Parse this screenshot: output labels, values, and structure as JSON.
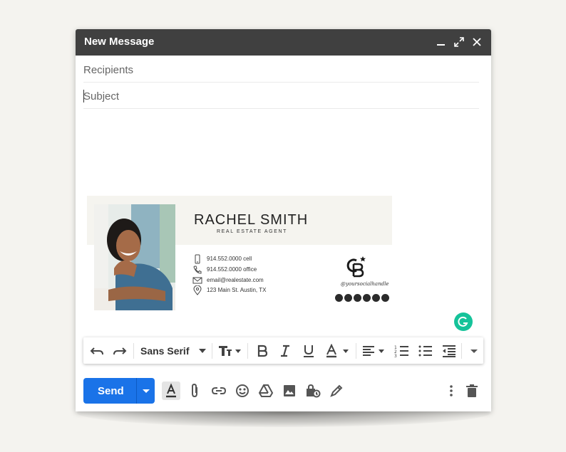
{
  "window": {
    "title": "New Message",
    "recipients_placeholder": "Recipients",
    "subject_placeholder": "Subject"
  },
  "signature": {
    "name": "RACHEL SMITH",
    "role": "REAL ESTATE AGENT",
    "cell": "914.552.0000 cell",
    "office": "914.552.0000 office",
    "email": "email@realestate.com",
    "address": "123 Main St. Austin, TX",
    "handle": "@yoursocialhandle",
    "socials": [
      "instagram-icon",
      "facebook-icon",
      "tiktok-icon",
      "twitter-icon",
      "linkedin-icon",
      "pinterest-icon"
    ]
  },
  "toolbar": {
    "font": "Sans Serif",
    "icons": [
      "undo-icon",
      "redo-icon",
      "font-size-icon",
      "bold-icon",
      "italic-icon",
      "underline-icon",
      "text-color-icon",
      "align-icon",
      "numbered-list-icon",
      "bulleted-list-icon",
      "indent-less-icon",
      "more-formatting-icon"
    ]
  },
  "bottom": {
    "send_label": "Send",
    "icons": [
      "formatting-icon",
      "attach-icon",
      "link-icon",
      "emoji-icon",
      "drive-icon",
      "photo-icon",
      "confidential-icon",
      "signature-icon",
      "more-options-icon",
      "delete-icon"
    ]
  },
  "colors": {
    "titlebar": "#404040",
    "send": "#1a73e8",
    "grammarly": "#15c39a",
    "banner": "#f5f4ef"
  }
}
